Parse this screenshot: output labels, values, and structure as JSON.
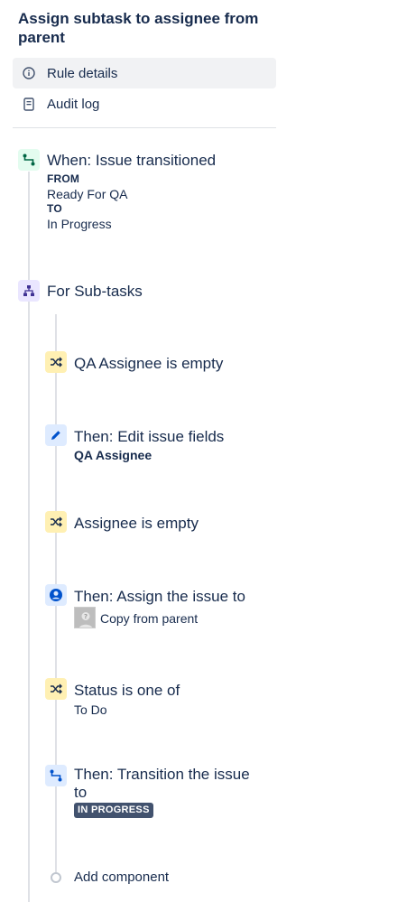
{
  "rule": {
    "title": "Assign subtask to assignee from parent"
  },
  "nav": {
    "rule_details": "Rule details",
    "audit_log": "Audit log"
  },
  "trigger": {
    "title": "When: Issue transitioned",
    "from_label": "FROM",
    "from_value": "Ready For QA",
    "to_label": "TO",
    "to_value": "In Progress",
    "icon": "transition-icon",
    "color": "#36b37e"
  },
  "branch": {
    "title": "For Sub-tasks",
    "icon": "hierarchy-icon",
    "color": "#6554c0"
  },
  "components": [
    {
      "kind": "condition",
      "title": "QA Assignee is empty",
      "icon": "shuffle-icon"
    },
    {
      "kind": "action",
      "title": "Then: Edit issue fields",
      "detail": "QA Assignee",
      "icon": "pencil-icon"
    },
    {
      "kind": "condition",
      "title": "Assignee is empty",
      "icon": "shuffle-icon"
    },
    {
      "kind": "action",
      "title": "Then: Assign the issue to",
      "detail": "Copy from parent",
      "icon": "user-circle-icon"
    },
    {
      "kind": "condition",
      "title": "Status is one of",
      "detail": "To Do",
      "icon": "shuffle-icon"
    },
    {
      "kind": "action",
      "title_line1": "Then: Transition the issue",
      "title_line2": "to",
      "lozenge": "IN PROGRESS",
      "icon": "transition-icon"
    }
  ],
  "add_component": "Add component",
  "colors": {
    "condition_bg": "#fff0b3",
    "action_bg": "#deebff",
    "action_icon": "#0052cc",
    "lozenge_bg": "#42526e"
  }
}
